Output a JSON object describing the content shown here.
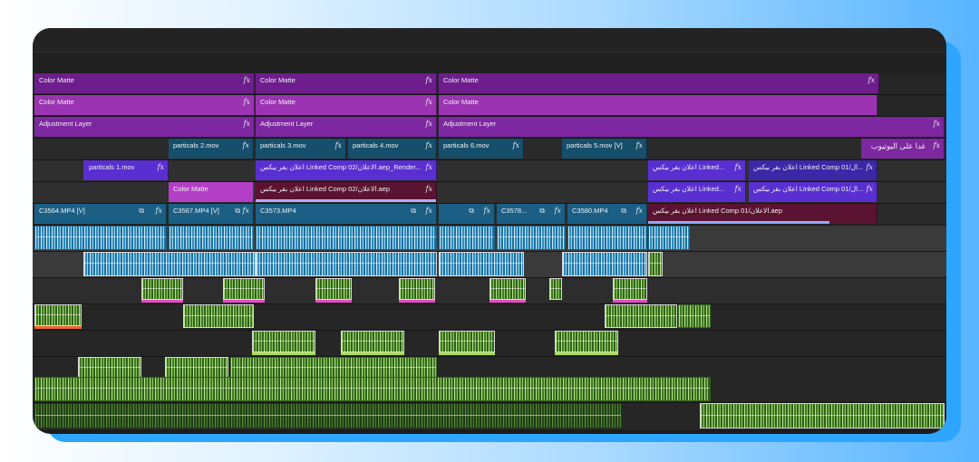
{
  "timeline": {
    "fx_label": "fx",
    "tracks": {
      "v8": [
        {
          "label": "Color Matte"
        },
        {
          "label": "Color Matte"
        },
        {
          "label": "Color Matte"
        }
      ],
      "v7": [
        {
          "label": "Color Matte"
        },
        {
          "label": "Color Matte"
        },
        {
          "label": "Color Matte"
        }
      ],
      "v6": [
        {
          "label": "Adjustment Layer"
        },
        {
          "label": "Adjustment Layer"
        },
        {
          "label": "Adjustment Layer"
        }
      ],
      "v5": [
        {
          "label": "particals 2.mov"
        },
        {
          "label": "particals 3.mov"
        },
        {
          "label": "particals 4.mov"
        },
        {
          "label": "particals 6.mov"
        },
        {
          "label": "particals 5.mov [V]"
        },
        {
          "label": "غدا على اليوتيوب"
        }
      ],
      "v4": [
        {
          "label": "particals 1.mov"
        },
        {
          "label": "اعلان بقر بيكس Linked Comp 02/الاعلان.aep_Render..."
        },
        {
          "label": "اعلان بقر بيكس Linked..."
        },
        {
          "label": "اعلان بقر بيكس Linked Comp 01/ال..."
        }
      ],
      "v3": [
        {
          "label": "Color Matte"
        },
        {
          "label": "اعلان بقر بيكس Linked Comp 02/الاعلان.aep"
        },
        {
          "label": "اعلان بقر بيكس Linked..."
        },
        {
          "label": "اعلان بقر بيكس Linked Comp 01/ال..."
        }
      ],
      "v2": [
        {
          "label": "C3564.MP4 [V]"
        },
        {
          "label": "C3567.MP4 [V]"
        },
        {
          "label": "C3573.MP4"
        },
        {
          "label": ""
        },
        {
          "label": "C3578..."
        },
        {
          "label": "C3580.MP4"
        },
        {
          "label": "اعلان بقر بيكس Linked Comp 01/الاعلان.aep"
        }
      ]
    }
  }
}
